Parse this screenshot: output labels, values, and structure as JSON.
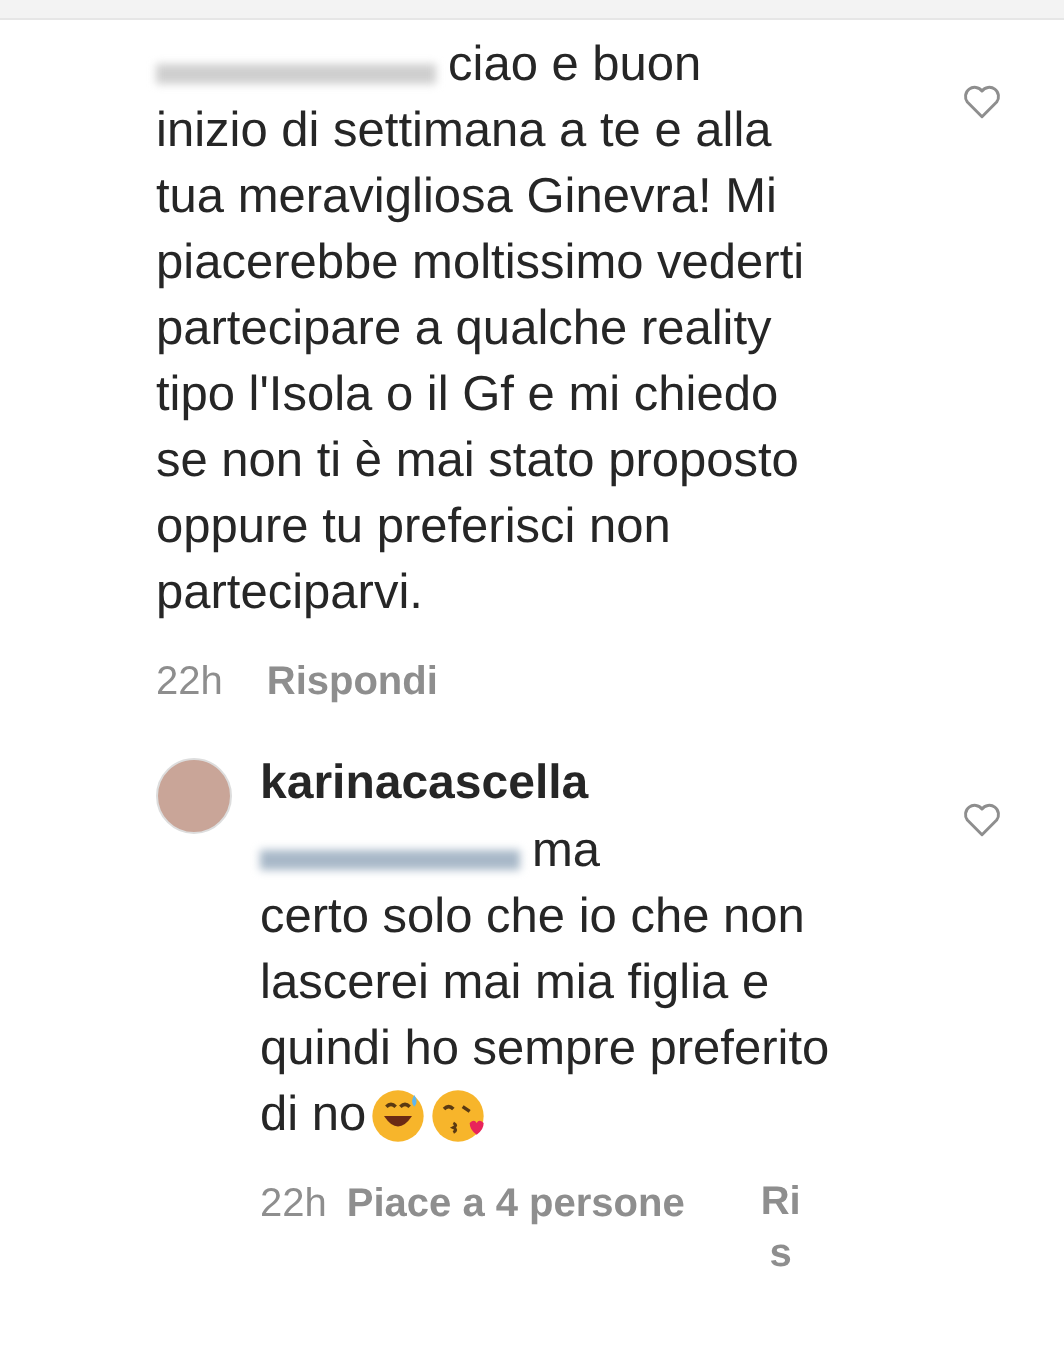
{
  "comments": [
    {
      "kind": "reply",
      "lines": [
        "ciao e buon",
        "inizio di settimana a te e alla",
        "tua meravigliosa Ginevra! Mi",
        "piacerebbe moltissimo vederti",
        "partecipare a qualche reality",
        "tipo l'Isola o il Gf e mi chiedo",
        "se non ti è mai stato proposto",
        "oppure tu preferisci non",
        "parteciparvi."
      ],
      "time": "22h",
      "reply": "Rispondi"
    },
    {
      "kind": "nested",
      "username": "karinacascella",
      "lines": [
        "ma",
        "certo solo che io che non",
        "lascerei mai mia figlia e",
        "quindi ho sempre preferito",
        "di no"
      ],
      "time": "22h",
      "likes": "Piace a 4 persone",
      "reply": "Ris"
    }
  ]
}
